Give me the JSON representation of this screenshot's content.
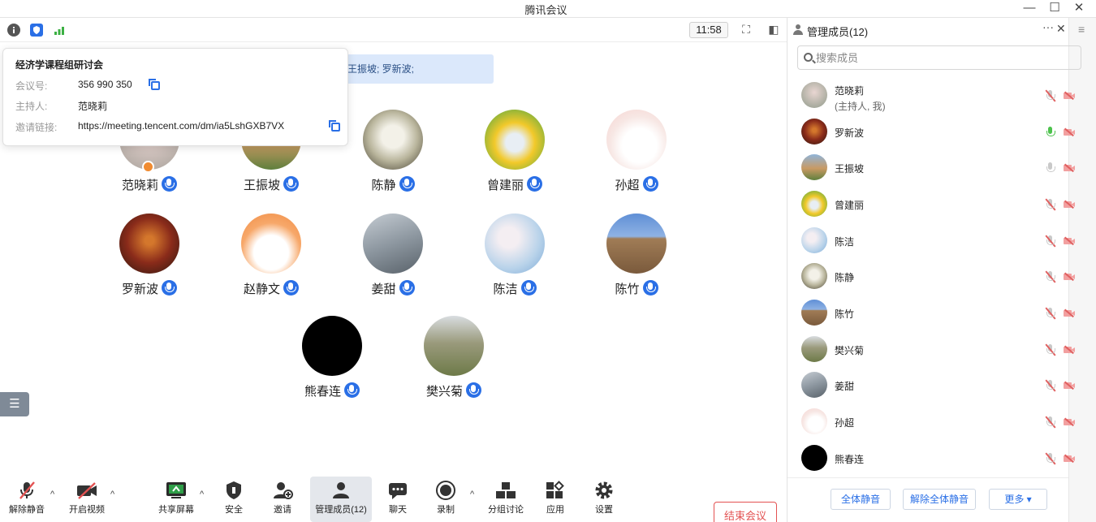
{
  "window": {
    "title": "腾讯会议"
  },
  "topbar": {
    "clock": "11:58"
  },
  "speaking": {
    "text": "王振坡; 罗新波;"
  },
  "info": {
    "title": "经济学课程组研讨会",
    "meeting_id_label": "会议号:",
    "meeting_id": "356 990 350",
    "host_label": "主持人:",
    "host": "范晓莉",
    "link_label": "邀请链接:",
    "link": "https://meeting.tencent.com/dm/ia5LshGXB7VX"
  },
  "participants": [
    {
      "name": "范晓莉"
    },
    {
      "name": "王振坡"
    },
    {
      "name": "陈静"
    },
    {
      "name": "曾建丽"
    },
    {
      "name": "孙超"
    },
    {
      "name": "罗新波"
    },
    {
      "name": "赵静文"
    },
    {
      "name": "姜甜"
    },
    {
      "name": "陈洁"
    },
    {
      "name": "陈竹"
    },
    {
      "name": "熊春连"
    },
    {
      "name": "樊兴菊"
    }
  ],
  "toolbar": {
    "unmute": "解除静音",
    "video": "开启视频",
    "share": "共享屏幕",
    "security": "安全",
    "invite": "邀请",
    "members": "管理成员(12)",
    "chat": "聊天",
    "record": "录制",
    "breakout": "分组讨论",
    "apps": "应用",
    "settings": "设置",
    "end": "结束会议"
  },
  "panel": {
    "title": "管理成员(12)",
    "search_placeholder": "搜索成员",
    "members": [
      {
        "name": "范晓莉",
        "sub": "(主持人, 我)",
        "mic": "off"
      },
      {
        "name": "罗新波",
        "mic": "on"
      },
      {
        "name": "王振坡",
        "mic": "idle"
      },
      {
        "name": "曾建丽",
        "mic": "off"
      },
      {
        "name": "陈洁",
        "mic": "off"
      },
      {
        "name": "陈静",
        "mic": "off"
      },
      {
        "name": "陈竹",
        "mic": "off"
      },
      {
        "name": "樊兴菊",
        "mic": "off"
      },
      {
        "name": "姜甜",
        "mic": "off"
      },
      {
        "name": "孙超",
        "mic": "off"
      },
      {
        "name": "熊春连",
        "mic": "off"
      }
    ],
    "mute_all": "全体静音",
    "unmute_all": "解除全体静音",
    "more": "更多 ▾"
  },
  "colors": {
    "accent": "#2a6fe6",
    "end": "#e35252",
    "active_mic": "#4cc24c"
  }
}
